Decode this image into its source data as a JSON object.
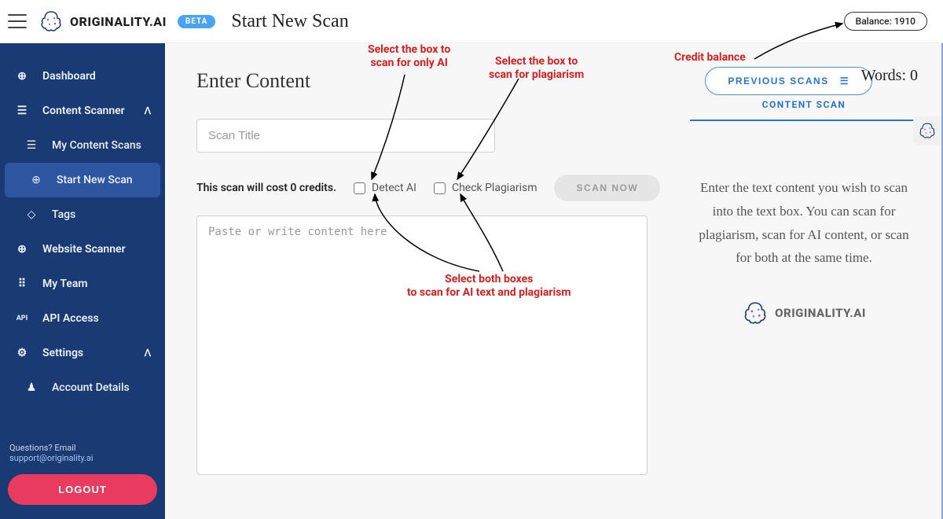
{
  "top": {
    "brand": "ORIGINALITY.AI",
    "beta": "BETA",
    "page_title": "Start New Scan",
    "balance": "Balance: 1910"
  },
  "sidebar": {
    "items": [
      {
        "label": "Dashboard"
      },
      {
        "label": "Content Scanner"
      },
      {
        "label": "My Content Scans"
      },
      {
        "label": "Start New Scan"
      },
      {
        "label": "Tags"
      },
      {
        "label": "Website Scanner"
      },
      {
        "label": "My Team"
      },
      {
        "label": "API Access"
      },
      {
        "label": "Settings"
      },
      {
        "label": "Account Details"
      }
    ],
    "support_prefix": "Questions? Email ",
    "support_email": "support@originality.ai",
    "logout": "LOGOUT"
  },
  "main": {
    "section_title": "Enter Content",
    "prev_scans": "PREVIOUS SCANS",
    "scan_title_placeholder": "Scan Title",
    "cost_text": "This scan will cost 0 credits.",
    "detect_ai": "Detect AI",
    "check_plag": "Check Plagiarism",
    "scan_now": "SCAN NOW",
    "content_placeholder": "Paste or write content here",
    "words": "Words: 0",
    "tab": "CONTENT SCAN",
    "info": "Enter the text content you wish to scan into the text box. You can scan for plagiarism, scan for AI content, or scan for both at the same time.",
    "info_brand": "ORIGINALITY.AI"
  },
  "annotations": {
    "a1": "Select the box to\nscan for only AI",
    "a2": "Select the box to\nscan for plagiarism",
    "a3": "Credit balance",
    "a4": "Select both boxes\nto scan for AI text and plagiarism"
  }
}
